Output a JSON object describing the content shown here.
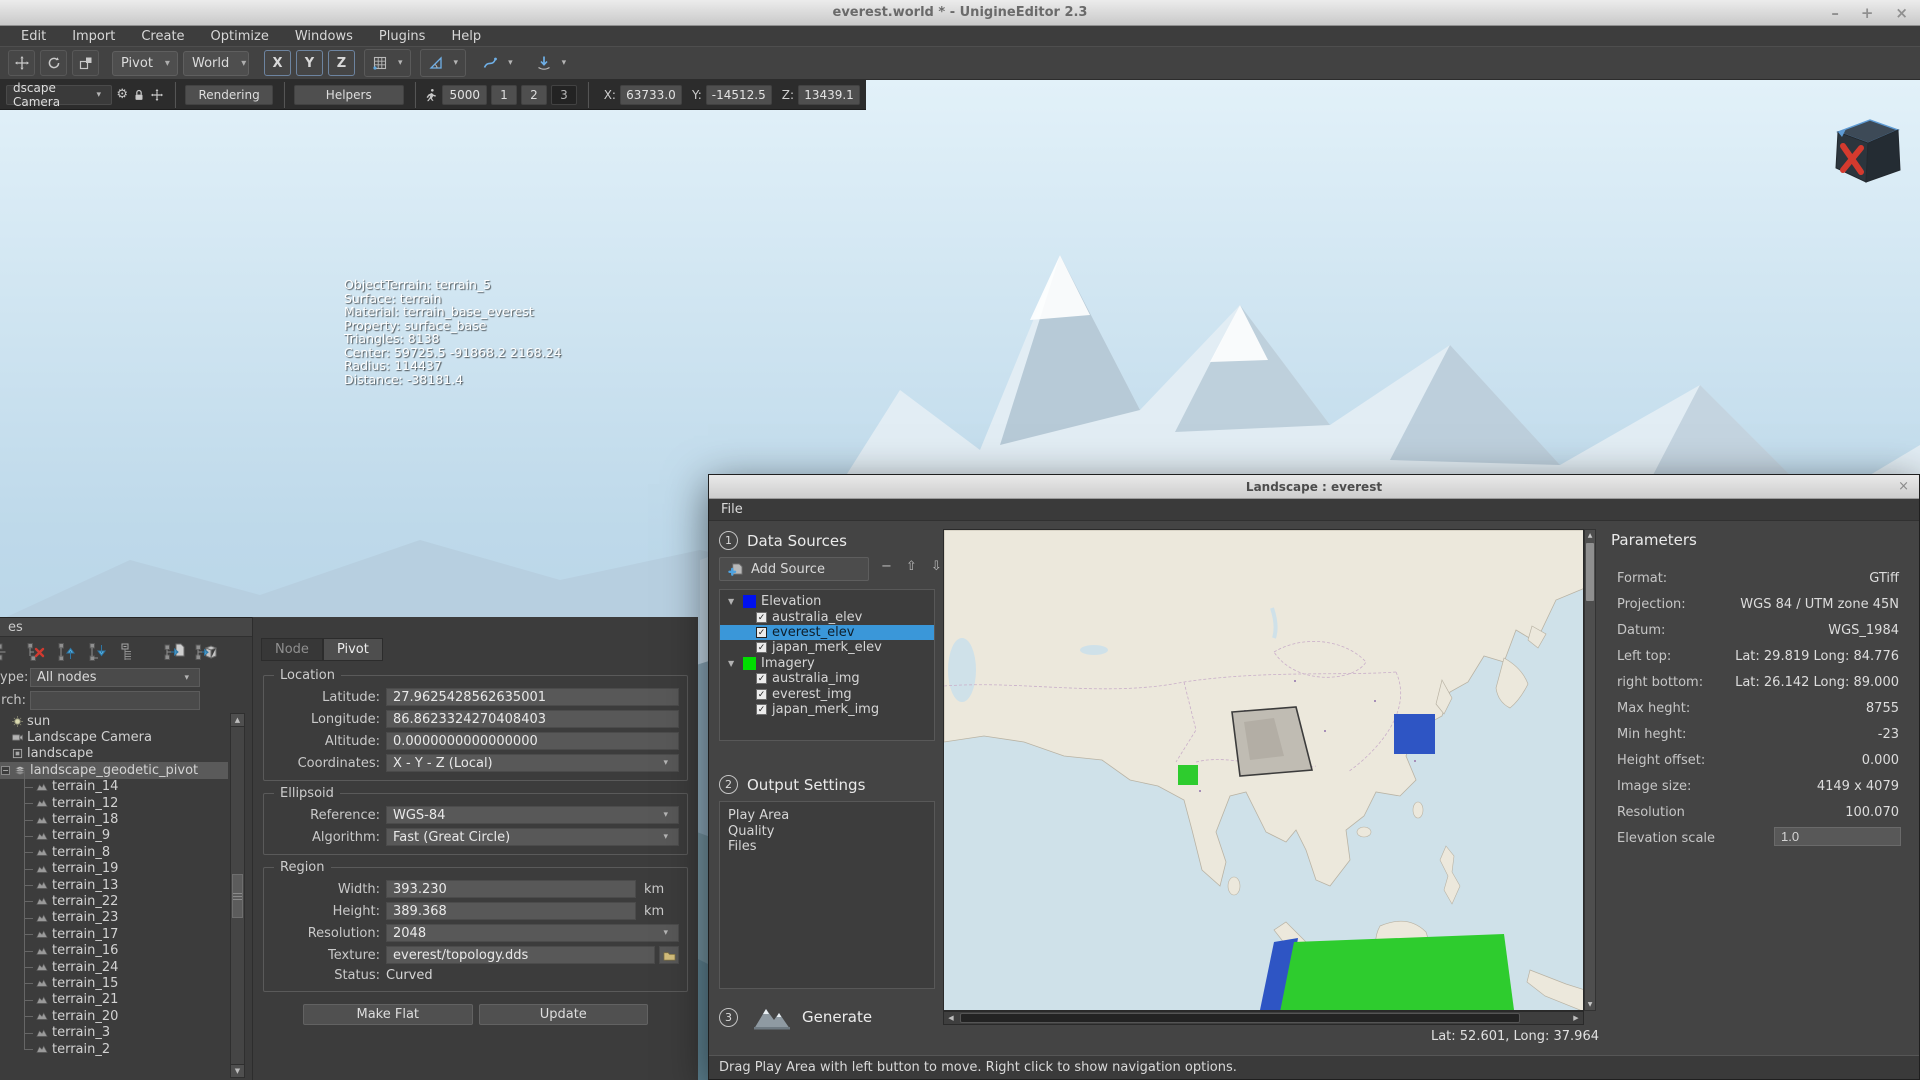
{
  "window": {
    "title": "everest.world * - UnigineEditor 2.3",
    "minimize": "–",
    "maximize": "+",
    "close": "×"
  },
  "menubar": {
    "items": [
      "Edit",
      "Import",
      "Create",
      "Optimize",
      "Windows",
      "Plugins",
      "Help"
    ]
  },
  "toolbar": {
    "pivot": "Pivot",
    "world": "World",
    "axis_x": "X",
    "axis_y": "Y",
    "axis_z": "Z"
  },
  "camera_bar": {
    "camera": "dscape Camera",
    "rendering": "Rendering",
    "helpers": "Helpers",
    "speed": "5000",
    "preset_1": "1",
    "preset_2": "2",
    "preset_3": "3",
    "x_label": "X:",
    "x_value": "63733.0",
    "y_label": "Y:",
    "y_value": "-14512.5",
    "z_label": "Z:",
    "z_value": "13439.1"
  },
  "viewport": {
    "debug_lines": [
      "ObjectTerrain: terrain_5",
      "Surface: terrain",
      "Material: terrain_base_everest",
      "Property: surface_base",
      "Triangles: 8138",
      "Center: 59725.5 -91868.2 2168.24",
      "Radius: 114437",
      "Distance: -38181.4"
    ]
  },
  "nodes_panel": {
    "header": "es",
    "close": "×",
    "type_label": "ype:",
    "type_value": "All nodes",
    "search_label": "rch:",
    "search_value": "",
    "expander": "−",
    "tree": [
      {
        "label": "sun"
      },
      {
        "label": "Landscape Camera"
      },
      {
        "label": "landscape"
      },
      {
        "label": "landscape_geodetic_pivot"
      },
      {
        "label": "terrain_14"
      },
      {
        "label": "terrain_12"
      },
      {
        "label": "terrain_18"
      },
      {
        "label": "terrain_9"
      },
      {
        "label": "terrain_8"
      },
      {
        "label": "terrain_19"
      },
      {
        "label": "terrain_13"
      },
      {
        "label": "terrain_22"
      },
      {
        "label": "terrain_23"
      },
      {
        "label": "terrain_17"
      },
      {
        "label": "terrain_16"
      },
      {
        "label": "terrain_24"
      },
      {
        "label": "terrain_15"
      },
      {
        "label": "terrain_21"
      },
      {
        "label": "terrain_20"
      },
      {
        "label": "terrain_3"
      },
      {
        "label": "terrain_2"
      }
    ]
  },
  "properties": {
    "tab_node": "Node",
    "tab_pivot": "Pivot",
    "location": {
      "legend": "Location",
      "latitude_label": "Latitude:",
      "latitude": "27.9625428562635001",
      "longitude_label": "Longitude:",
      "longitude": "86.8623324270408403",
      "altitude_label": "Altitude:",
      "altitude": "0.0000000000000000",
      "coordinates_label": "Coordinates:",
      "coordinates": "X - Y - Z (Local)"
    },
    "ellipsoid": {
      "legend": "Ellipsoid",
      "reference_label": "Reference:",
      "reference": "WGS-84",
      "algorithm_label": "Algorithm:",
      "algorithm": "Fast (Great Circle)"
    },
    "region": {
      "legend": "Region",
      "width_label": "Width:",
      "width": "393.230",
      "width_unit": "km",
      "height_label": "Height:",
      "height": "389.368",
      "height_unit": "km",
      "resolution_label": "Resolution:",
      "resolution": "2048",
      "texture_label": "Texture:",
      "texture": "everest/topology.dds",
      "status_label": "Status:",
      "status": "Curved"
    },
    "make_flat": "Make Flat",
    "update": "Update"
  },
  "dialog": {
    "title": "Landscape : everest",
    "close": "×",
    "menu_file": "File",
    "step1_num": "1",
    "step1_title": "Data Sources",
    "add_source": "Add Source",
    "sources": [
      {
        "label": "Elevation",
        "color": "#0011ee",
        "items": [
          {
            "label": "australia_elev"
          },
          {
            "label": "everest_elev"
          },
          {
            "label": "japan_merk_elev"
          }
        ]
      },
      {
        "label": "Imagery",
        "color": "#00dd00",
        "items": [
          {
            "label": "australia_img"
          },
          {
            "label": "everest_img"
          },
          {
            "label": "japan_merk_img"
          }
        ]
      }
    ],
    "selected_source": "everest_elev",
    "step2_num": "2",
    "step2_title": "Output Settings",
    "output_items": [
      "Play Area",
      "Quality",
      "Files"
    ],
    "step3_num": "3",
    "generate": "Generate",
    "map_status": "Lat: 52.601, Long: 37.964",
    "status_bar": "Drag Play Area with left button to move. Right click to show navigation options.",
    "map_overlays": {
      "play_area_gray": "#c0bcb3",
      "japan_region_blue": "#2e55c4",
      "nepal_region_green": "#2ecc2e",
      "australia_region_green": "#2ecc2e",
      "australia_region_blue": "#2e55c4"
    },
    "parameters": {
      "heading": "Parameters",
      "rows": [
        {
          "label": "Format:",
          "value": "GTiff"
        },
        {
          "label": "Projection:",
          "value": "WGS 84 / UTM zone 45N"
        },
        {
          "label": "Datum:",
          "value": "WGS_1984"
        },
        {
          "label": "Left top:",
          "value": "Lat: 29.819 Long: 84.776"
        },
        {
          "label": "right bottom:",
          "value": "Lat: 26.142 Long: 89.000"
        },
        {
          "label": "Max heght:",
          "value": "8755"
        },
        {
          "label": "Min heght:",
          "value": "-23"
        },
        {
          "label": "Height offset:",
          "value": "0.000"
        },
        {
          "label": "Image size:",
          "value": "4149 x 4079"
        },
        {
          "label": "Resolution",
          "value": "100.070"
        }
      ],
      "elevation_scale_label": "Elevation scale",
      "elevation_scale_value": "1.0"
    }
  }
}
